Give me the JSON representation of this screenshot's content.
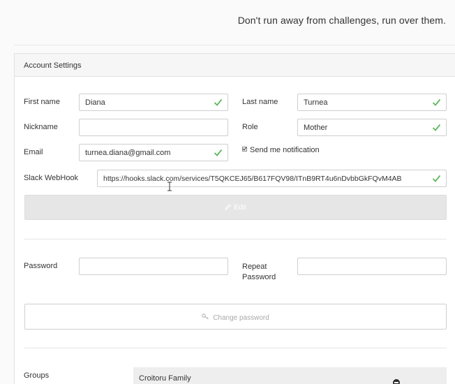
{
  "header": {
    "quote": "Don't run away from challenges, run over them."
  },
  "panel": {
    "title": "Account Settings"
  },
  "form": {
    "first_name": {
      "label": "First name",
      "value": "Diana",
      "valid": true
    },
    "last_name": {
      "label": "Last name",
      "value": "Turnea",
      "valid": true
    },
    "nickname": {
      "label": "Nickname",
      "value": ""
    },
    "role": {
      "label": "Role",
      "value": "Mother",
      "valid": true
    },
    "email": {
      "label": "Email",
      "value": "turnea.diana@gmail.com",
      "valid": true
    },
    "notification": {
      "label": "Send me notification",
      "checked": true
    },
    "slack": {
      "label": "Slack WebHook",
      "value": "https://hooks.slack.com/services/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",
      "valid": true
    },
    "edit_button": {
      "label": "Edit",
      "icon": "edit-icon"
    }
  },
  "password_form": {
    "password": {
      "label": "Password",
      "value": ""
    },
    "repeat_password": {
      "label_line1": "Repeat",
      "label_line2": "Password",
      "value": ""
    },
    "change_button": {
      "label": "Change password",
      "icon": "key-icon"
    }
  },
  "groups": {
    "label": "Groups",
    "items": [
      {
        "name": "Croitoru Family",
        "action_icon": "minus-circle-icon"
      }
    ]
  },
  "colors": {
    "valid_check": "#5cb85c",
    "disabled_button": "#e6e6e6"
  }
}
